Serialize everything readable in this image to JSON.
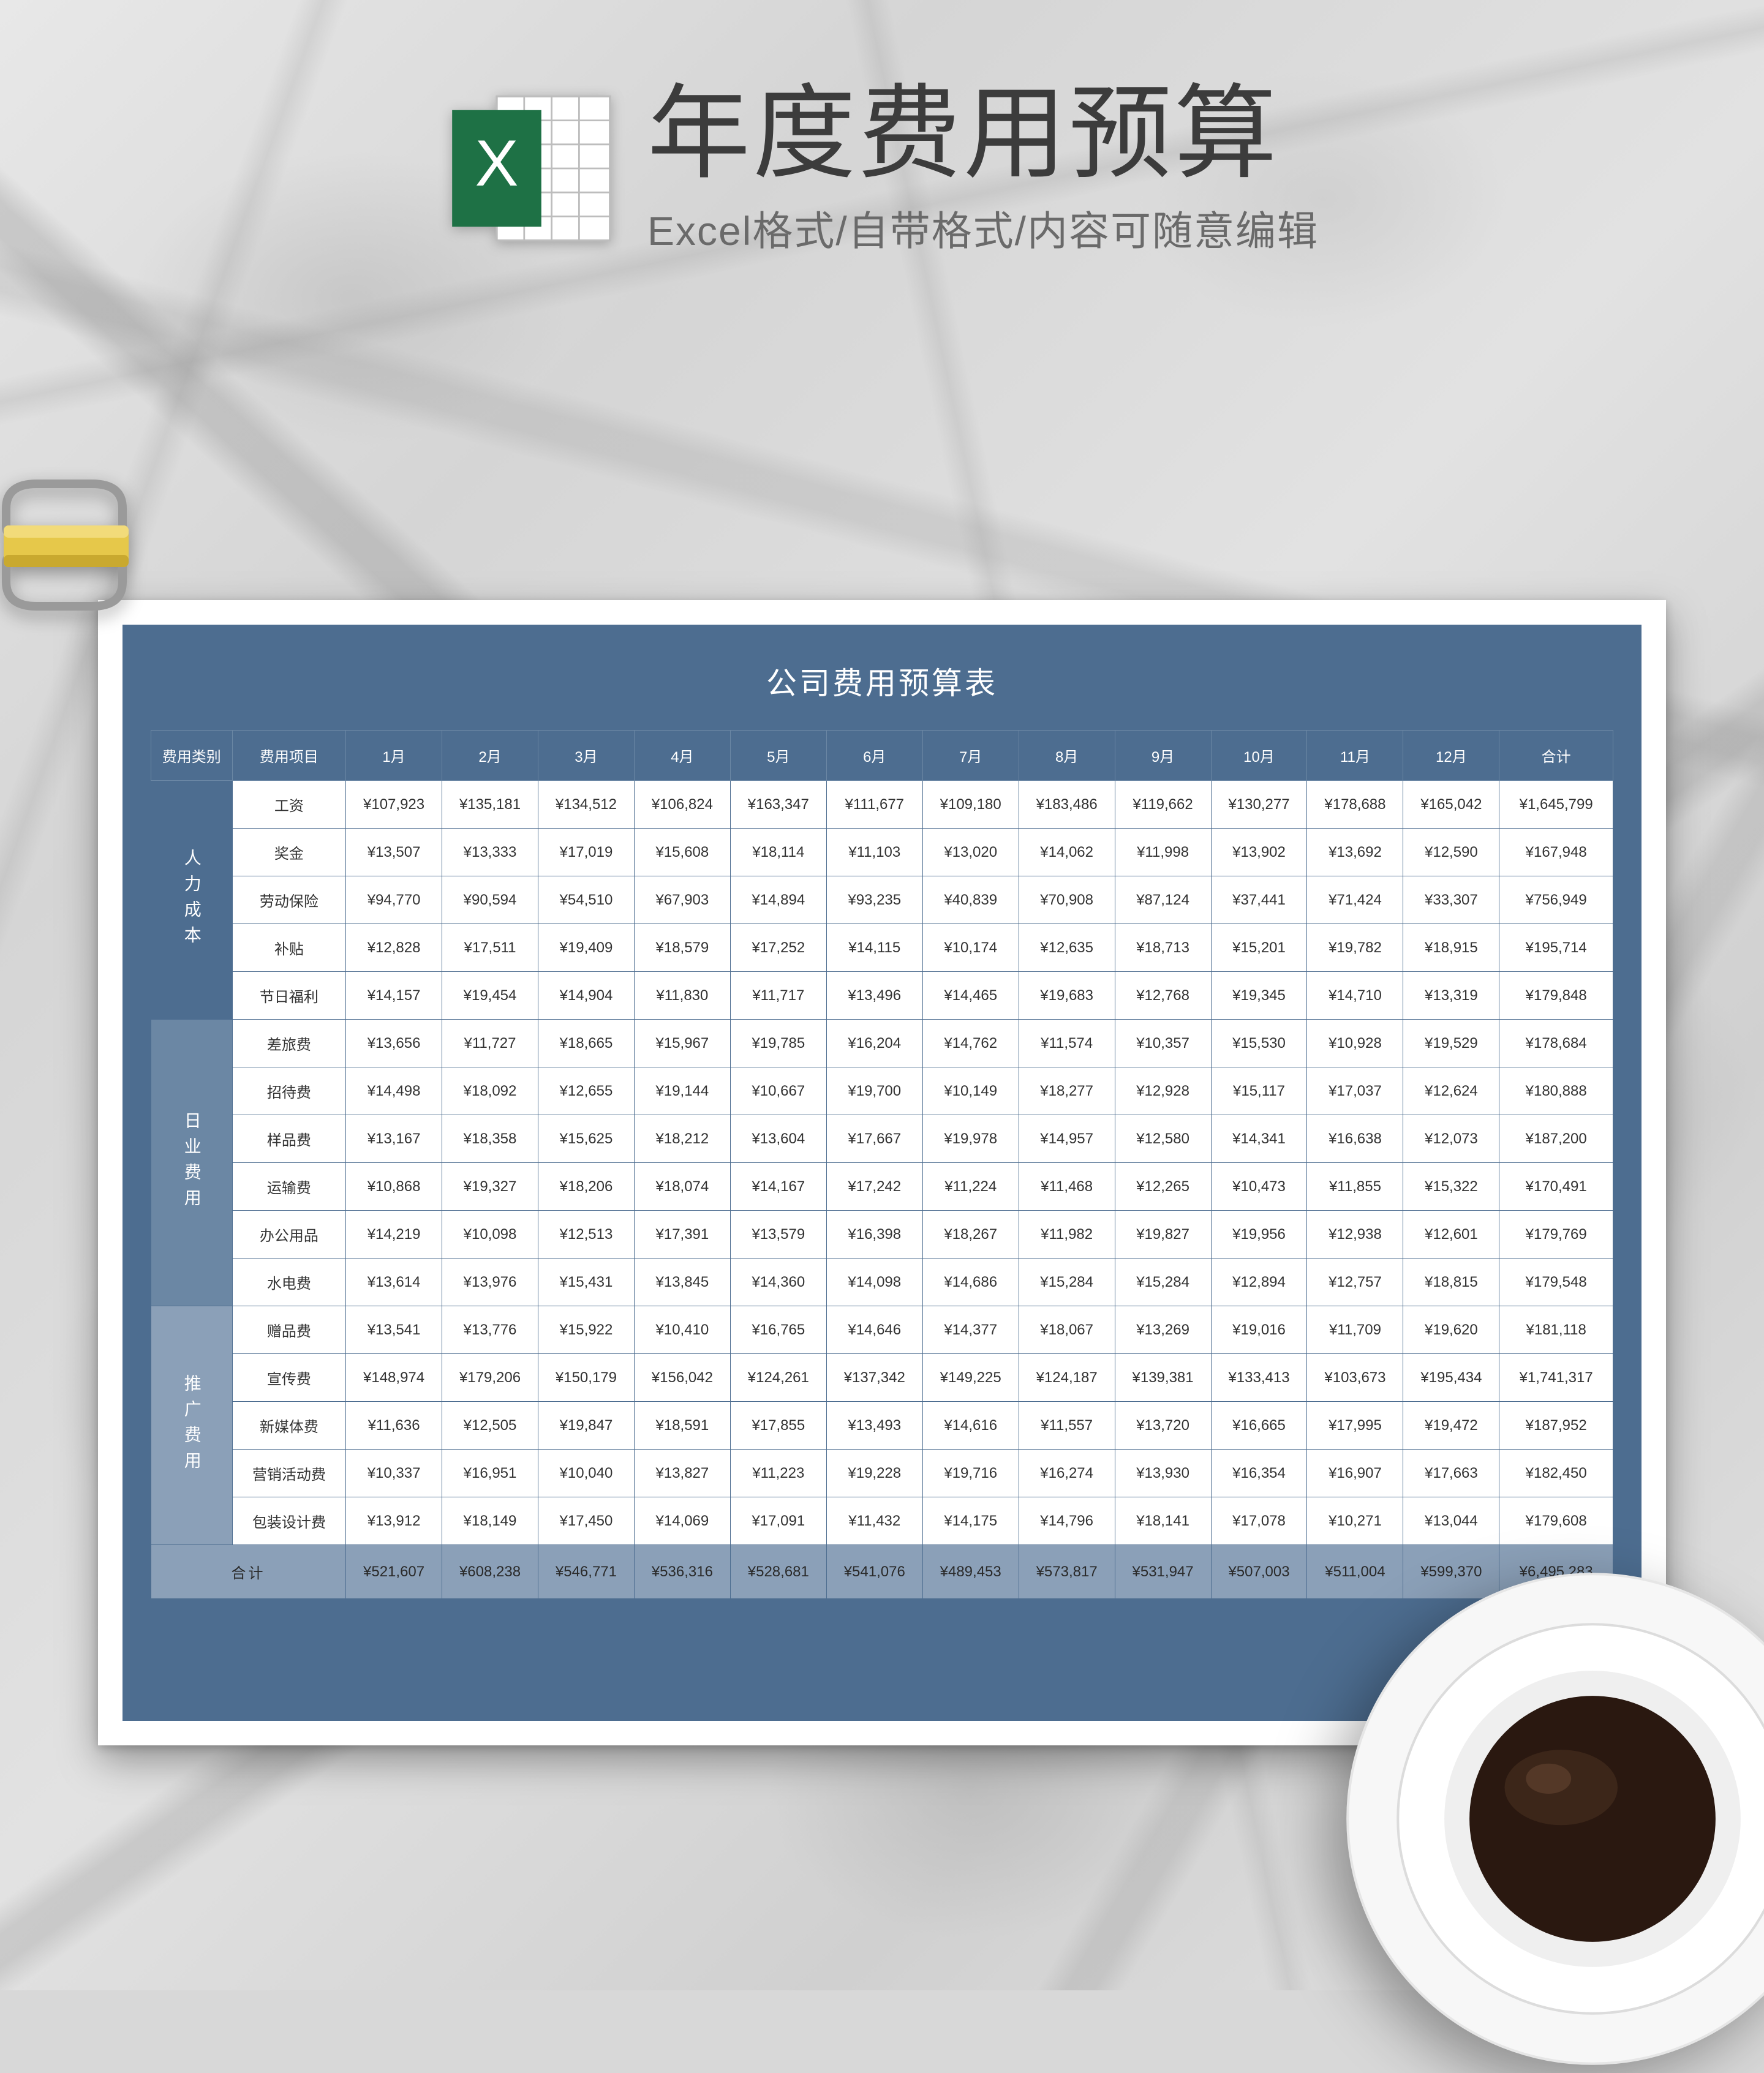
{
  "header": {
    "title": "年度费用预算",
    "subtitle": "Excel格式/自带格式/内容可随意编辑",
    "icon_name": "excel-icon"
  },
  "sheet": {
    "title": "公司费用预算表",
    "columns": [
      "费用类别",
      "费用项目",
      "1月",
      "2月",
      "3月",
      "4月",
      "5月",
      "6月",
      "7月",
      "8月",
      "9月",
      "10月",
      "11月",
      "12月",
      "合计"
    ],
    "categories": [
      {
        "name": "人力成本",
        "rows": [
          {
            "item": "工资",
            "values": [
              "¥107,923",
              "¥135,181",
              "¥134,512",
              "¥106,824",
              "¥163,347",
              "¥111,677",
              "¥109,180",
              "¥183,486",
              "¥119,662",
              "¥130,277",
              "¥178,688",
              "¥165,042"
            ],
            "total": "¥1,645,799"
          },
          {
            "item": "奖金",
            "values": [
              "¥13,507",
              "¥13,333",
              "¥17,019",
              "¥15,608",
              "¥18,114",
              "¥11,103",
              "¥13,020",
              "¥14,062",
              "¥11,998",
              "¥13,902",
              "¥13,692",
              "¥12,590"
            ],
            "total": "¥167,948"
          },
          {
            "item": "劳动保险",
            "values": [
              "¥94,770",
              "¥90,594",
              "¥54,510",
              "¥67,903",
              "¥14,894",
              "¥93,235",
              "¥40,839",
              "¥70,908",
              "¥87,124",
              "¥37,441",
              "¥71,424",
              "¥33,307"
            ],
            "total": "¥756,949"
          },
          {
            "item": "补贴",
            "values": [
              "¥12,828",
              "¥17,511",
              "¥19,409",
              "¥18,579",
              "¥17,252",
              "¥14,115",
              "¥10,174",
              "¥12,635",
              "¥18,713",
              "¥15,201",
              "¥19,782",
              "¥18,915"
            ],
            "total": "¥195,714"
          },
          {
            "item": "节日福利",
            "values": [
              "¥14,157",
              "¥19,454",
              "¥14,904",
              "¥11,830",
              "¥11,717",
              "¥13,496",
              "¥14,465",
              "¥19,683",
              "¥12,768",
              "¥19,345",
              "¥14,710",
              "¥13,319"
            ],
            "total": "¥179,848"
          }
        ]
      },
      {
        "name": "日业费用",
        "rows": [
          {
            "item": "差旅费",
            "values": [
              "¥13,656",
              "¥11,727",
              "¥18,665",
              "¥15,967",
              "¥19,785",
              "¥16,204",
              "¥14,762",
              "¥11,574",
              "¥10,357",
              "¥15,530",
              "¥10,928",
              "¥19,529"
            ],
            "total": "¥178,684"
          },
          {
            "item": "招待费",
            "values": [
              "¥14,498",
              "¥18,092",
              "¥12,655",
              "¥19,144",
              "¥10,667",
              "¥19,700",
              "¥10,149",
              "¥18,277",
              "¥12,928",
              "¥15,117",
              "¥17,037",
              "¥12,624"
            ],
            "total": "¥180,888"
          },
          {
            "item": "样品费",
            "values": [
              "¥13,167",
              "¥18,358",
              "¥15,625",
              "¥18,212",
              "¥13,604",
              "¥17,667",
              "¥19,978",
              "¥14,957",
              "¥12,580",
              "¥14,341",
              "¥16,638",
              "¥12,073"
            ],
            "total": "¥187,200"
          },
          {
            "item": "运输费",
            "values": [
              "¥10,868",
              "¥19,327",
              "¥18,206",
              "¥18,074",
              "¥14,167",
              "¥17,242",
              "¥11,224",
              "¥11,468",
              "¥12,265",
              "¥10,473",
              "¥11,855",
              "¥15,322"
            ],
            "total": "¥170,491"
          },
          {
            "item": "办公用品",
            "values": [
              "¥14,219",
              "¥10,098",
              "¥12,513",
              "¥17,391",
              "¥13,579",
              "¥16,398",
              "¥18,267",
              "¥11,982",
              "¥19,827",
              "¥19,956",
              "¥12,938",
              "¥12,601"
            ],
            "total": "¥179,769"
          },
          {
            "item": "水电费",
            "values": [
              "¥13,614",
              "¥13,976",
              "¥15,431",
              "¥13,845",
              "¥14,360",
              "¥14,098",
              "¥14,686",
              "¥15,284",
              "¥15,284",
              "¥12,894",
              "¥12,757",
              "¥18,815"
            ],
            "total": "¥179,548"
          }
        ]
      },
      {
        "name": "推广费用",
        "rows": [
          {
            "item": "赠品费",
            "values": [
              "¥13,541",
              "¥13,776",
              "¥15,922",
              "¥10,410",
              "¥16,765",
              "¥14,646",
              "¥14,377",
              "¥18,067",
              "¥13,269",
              "¥19,016",
              "¥11,709",
              "¥19,620"
            ],
            "total": "¥181,118"
          },
          {
            "item": "宣传费",
            "values": [
              "¥148,974",
              "¥179,206",
              "¥150,179",
              "¥156,042",
              "¥124,261",
              "¥137,342",
              "¥149,225",
              "¥124,187",
              "¥139,381",
              "¥133,413",
              "¥103,673",
              "¥195,434"
            ],
            "total": "¥1,741,317"
          },
          {
            "item": "新媒体费",
            "values": [
              "¥11,636",
              "¥12,505",
              "¥19,847",
              "¥18,591",
              "¥17,855",
              "¥13,493",
              "¥14,616",
              "¥11,557",
              "¥13,720",
              "¥16,665",
              "¥17,995",
              "¥19,472"
            ],
            "total": "¥187,952"
          },
          {
            "item": "营销活动费",
            "values": [
              "¥10,337",
              "¥16,951",
              "¥10,040",
              "¥13,827",
              "¥11,223",
              "¥19,228",
              "¥19,716",
              "¥16,274",
              "¥13,930",
              "¥16,354",
              "¥16,907",
              "¥17,663"
            ],
            "total": "¥182,450"
          },
          {
            "item": "包装设计费",
            "values": [
              "¥13,912",
              "¥18,149",
              "¥17,450",
              "¥14,069",
              "¥17,091",
              "¥11,432",
              "¥14,175",
              "¥14,796",
              "¥18,141",
              "¥17,078",
              "¥10,271",
              "¥13,044"
            ],
            "total": "¥179,608"
          }
        ]
      }
    ],
    "footer": {
      "label": "合计",
      "values": [
        "¥521,607",
        "¥608,238",
        "¥546,771",
        "¥536,316",
        "¥528,681",
        "¥541,076",
        "¥489,453",
        "¥573,817",
        "¥531,947",
        "¥507,003",
        "¥511,004",
        "¥599,370"
      ],
      "total": "¥6,495,283"
    }
  }
}
